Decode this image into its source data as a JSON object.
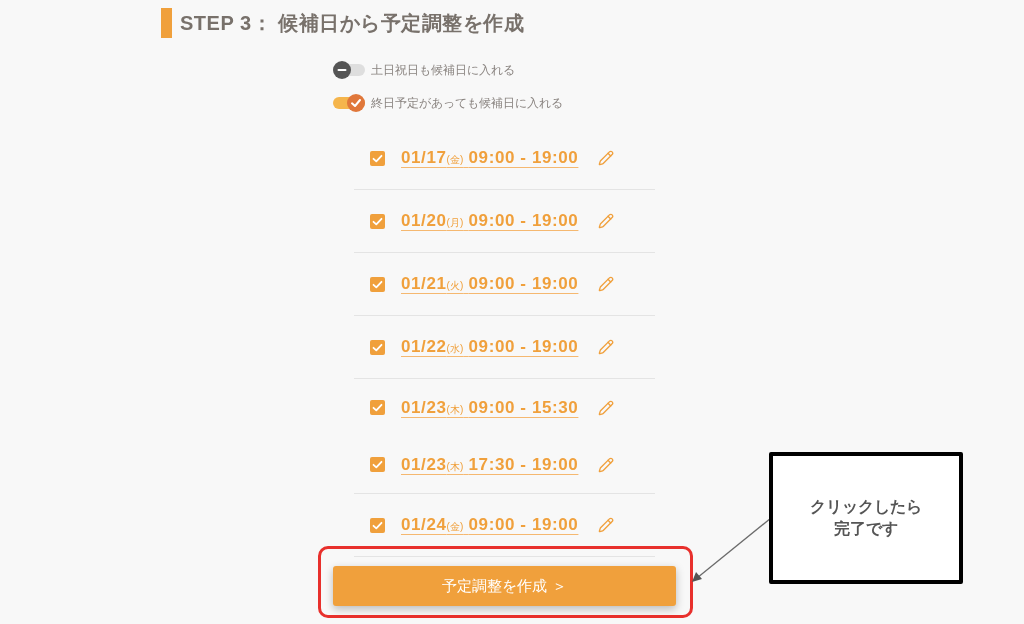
{
  "step_heading": "STEP 3： 候補日から予定調整を作成",
  "toggles": [
    {
      "label": "土日祝日も候補日に入れる",
      "on": false
    },
    {
      "label": "終日予定があっても候補日に入れる",
      "on": true
    }
  ],
  "candidate_days": [
    {
      "slots": [
        {
          "checked": true,
          "date": "01/17",
          "weekday": "(金)",
          "time": "09:00 - 19:00"
        }
      ]
    },
    {
      "slots": [
        {
          "checked": true,
          "date": "01/20",
          "weekday": "(月)",
          "time": "09:00 - 19:00"
        }
      ]
    },
    {
      "slots": [
        {
          "checked": true,
          "date": "01/21",
          "weekday": "(火)",
          "time": "09:00 - 19:00"
        }
      ]
    },
    {
      "slots": [
        {
          "checked": true,
          "date": "01/22",
          "weekday": "(水)",
          "time": "09:00 - 19:00"
        }
      ]
    },
    {
      "slots": [
        {
          "checked": true,
          "date": "01/23",
          "weekday": "(木)",
          "time": "09:00 - 15:30"
        },
        {
          "checked": true,
          "date": "01/23",
          "weekday": "(木)",
          "time": "17:30 - 19:00"
        }
      ]
    },
    {
      "slots": [
        {
          "checked": true,
          "date": "01/24",
          "weekday": "(金)",
          "time": "09:00 - 19:00"
        }
      ]
    }
  ],
  "create_button": {
    "label": "予定調整を作成 ＞"
  },
  "annotation": {
    "callout_lines": [
      "クリックしたら",
      "完了です"
    ]
  }
}
